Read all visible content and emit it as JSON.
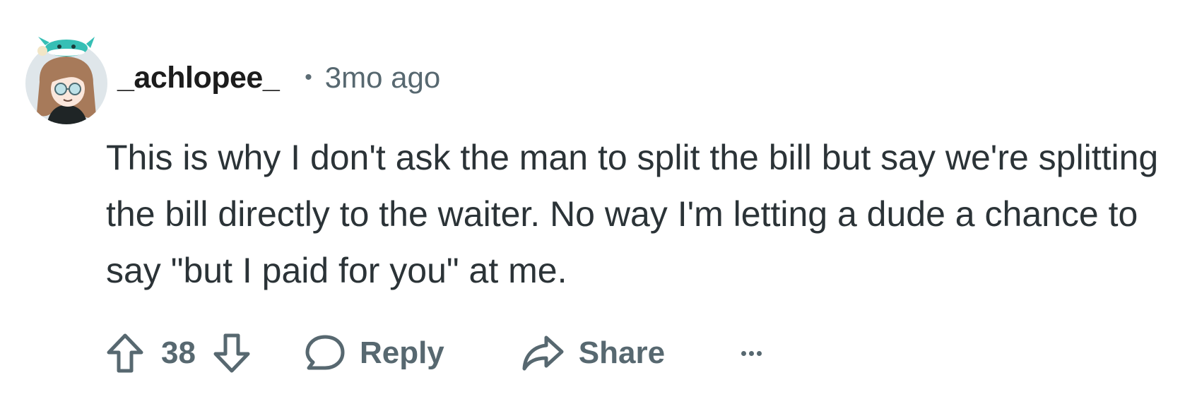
{
  "comment": {
    "username": "_achlopee_",
    "separator": "•",
    "timestamp": "3mo ago",
    "body": "This is why I don't ask the man to split the bill but say we're splitting the bill directly to the waiter. No way I'm letting a dude a chance to say \"but I paid for you\" at me.",
    "avatar_icon": "avatar-icon",
    "colors": {
      "text": "#2b3337",
      "muted": "#576870",
      "username": "#1c1c1c"
    }
  },
  "actions": {
    "vote_count": "38",
    "reply_label": "Reply",
    "share_label": "Share",
    "upvote_icon": "upvote-arrow-icon",
    "downvote_icon": "downvote-arrow-icon",
    "reply_icon": "speech-bubble-icon",
    "share_icon": "share-arrow-icon",
    "more_icon": "ellipsis-icon"
  }
}
